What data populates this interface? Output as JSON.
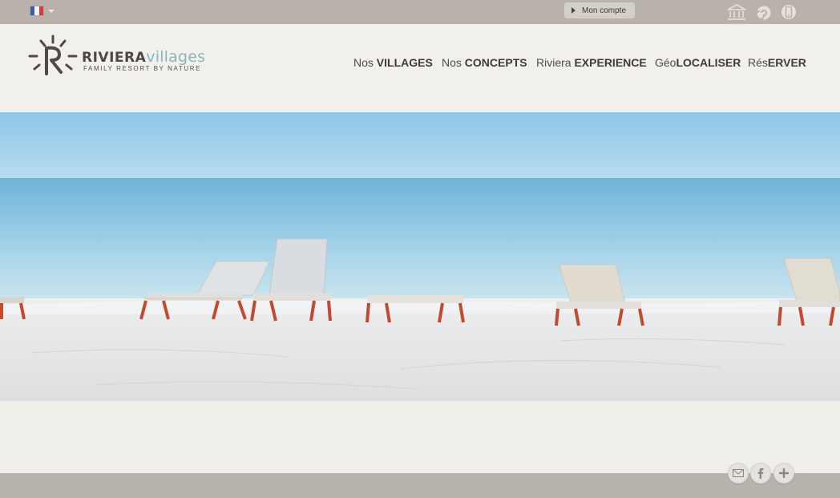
{
  "topbar": {
    "language": {
      "selected": "Français",
      "flag_colors": [
        "#3a5fb0",
        "#f5f5f5",
        "#d63a3a"
      ]
    },
    "account_button": "Mon compte",
    "icons": [
      "institution-icon",
      "spiral-icon",
      "mobile-icon"
    ]
  },
  "header": {
    "logo": {
      "brand_part1": "RIVIERA",
      "brand_part2": "villages",
      "tagline": "FAMILY RESORT BY NATURE"
    },
    "nav": [
      {
        "prefix": "Nos ",
        "bold": "VILLAGES"
      },
      {
        "prefix": "Nos ",
        "bold": "CONCEPTS"
      },
      {
        "prefix": "Riviera ",
        "bold": "EXPERIENCE"
      },
      {
        "prefix": "Géo",
        "bold": "LOCALISER"
      },
      {
        "prefix": "Rés",
        "bold": "ERVER"
      }
    ]
  },
  "hero": {
    "image": "beach-with-lounge-chairs"
  },
  "footer": {
    "share_icons": [
      "mail-icon",
      "facebook-icon",
      "plus-icon"
    ]
  },
  "colors": {
    "topbar": "#b8b2ab",
    "header_bg": "#f1f0eb",
    "footer": "#b8b3ac",
    "brand_blue": "#8fb2c3",
    "text_dark": "#4c4742"
  }
}
